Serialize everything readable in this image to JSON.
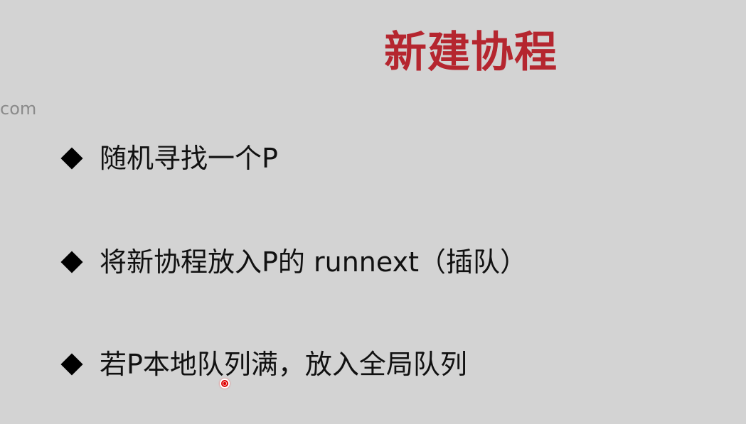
{
  "slide": {
    "title": "新建协程",
    "watermark": "com",
    "bullets": [
      "随机寻找一个P",
      "将新协程放入P的 runnext（插队）",
      "若P本地队列满，放入全局队列"
    ]
  },
  "colors": {
    "background": "#d3d3d3",
    "title": "#b5262f",
    "bullet_text": "#111111",
    "pointer": "#e00000"
  },
  "icons": {
    "bullet": "diamond-bullet-icon",
    "cursor": "laser-pointer-icon"
  }
}
